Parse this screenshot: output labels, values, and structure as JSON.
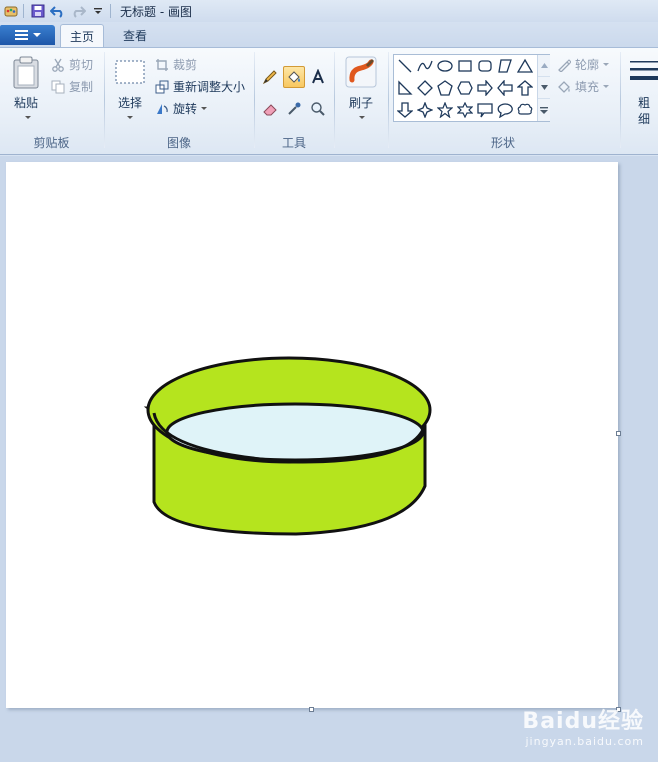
{
  "window": {
    "title": "无标题 - 画图"
  },
  "tabs": [
    {
      "label": "主页",
      "active": true
    },
    {
      "label": "查看",
      "active": false
    }
  ],
  "clipboard": {
    "group_label": "剪贴板",
    "paste_label": "粘贴",
    "cut_label": "剪切",
    "copy_label": "复制"
  },
  "image": {
    "group_label": "图像",
    "select_label": "选择",
    "crop_label": "裁剪",
    "resize_label": "重新调整大小",
    "rotate_label": "旋转"
  },
  "tools": {
    "group_label": "工具",
    "items": [
      "pencil-icon",
      "fill-bucket-icon",
      "text-icon",
      "eraser-icon",
      "color-picker-icon",
      "magnifier-icon"
    ],
    "selected": "fill-bucket-icon"
  },
  "brushes": {
    "label": "刷子"
  },
  "shapes": {
    "group_label": "形状",
    "outline_label": "轮廓",
    "fill_label": "填充"
  },
  "size": {
    "label_line1": "粗",
    "label_line2": "细"
  },
  "drawing": {
    "fill_color": "#b5e41e",
    "inner_color": "#dff3f8",
    "stroke_color": "#111111"
  },
  "watermark": {
    "main": "Baidu经验",
    "sub": "jingyan.baidu.com"
  }
}
